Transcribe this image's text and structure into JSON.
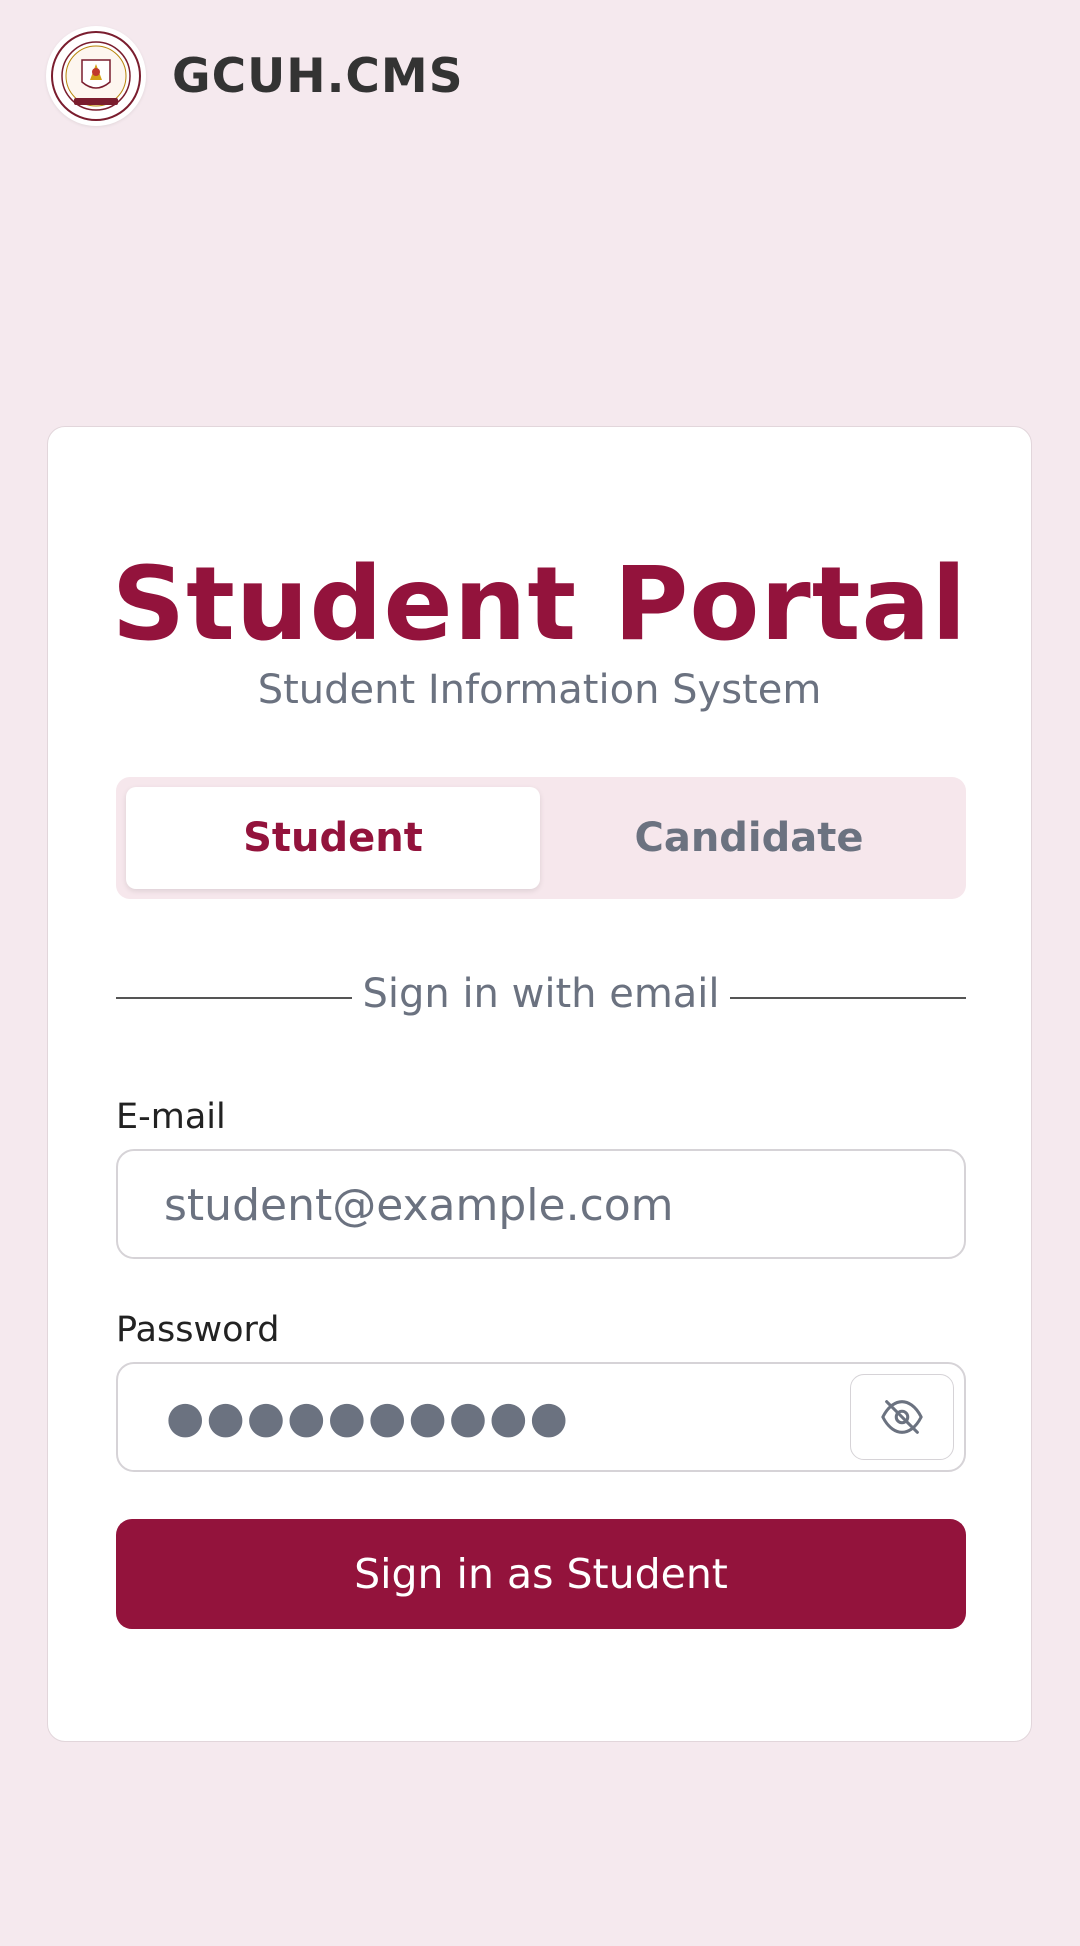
{
  "header": {
    "brand": "GCUH.CMS"
  },
  "card": {
    "title": "Student Portal",
    "subtitle": "Student Information System",
    "tabs": [
      {
        "label": "Student",
        "active": true
      },
      {
        "label": "Candidate",
        "active": false
      }
    ],
    "divider_text": "Sign in with email",
    "email": {
      "label": "E-mail",
      "placeholder": "student@example.com",
      "value": ""
    },
    "password": {
      "label": "Password",
      "masked_value": "●●●●●●●●●●",
      "toggle_icon": "eye-off-icon"
    },
    "submit_label": "Sign in as Student"
  },
  "colors": {
    "accent": "#93133c",
    "background": "#f5e9ee",
    "muted_text": "#6b7280"
  }
}
